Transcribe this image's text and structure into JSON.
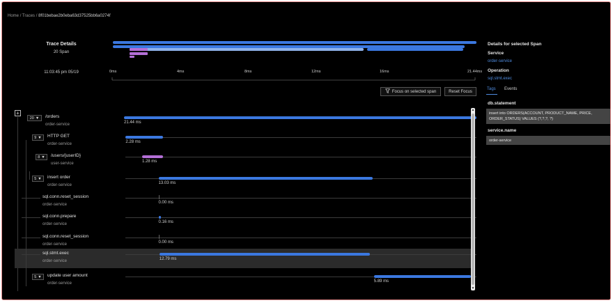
{
  "breadcrumb": {
    "home": "Home",
    "separator": "/",
    "traces": "Traces",
    "trace_id": "8f01bebae2b0eba63d37525bb6a0274f"
  },
  "summary": {
    "title": "Trace Details",
    "span_count": "20 Span",
    "start_time": "11:03:45 pm 05/19"
  },
  "timeline_ticks": [
    "0ms",
    "4ms",
    "8ms",
    "12ms",
    "16ms",
    "21.44ms"
  ],
  "buttons": {
    "focus_icon": "funnel-icon",
    "focus": "Focus on selected span",
    "reset": "Reset Focus"
  },
  "colors": {
    "span_bar": "#3b78e0",
    "user_service_bar": "#b36fd6",
    "link": "#4f8ce0"
  },
  "trace_duration_ms": 21.44,
  "spans": [
    {
      "name": "/orders",
      "service": "order-service",
      "duration": "21.44 ms",
      "start_ms": 0,
      "duration_ms": 21.44,
      "toggle": "20",
      "depth": 0,
      "color": "blue"
    },
    {
      "name": "HTTP GET",
      "service": "order-service",
      "duration": "2.28 ms",
      "start_ms": 0.1,
      "duration_ms": 2.28,
      "toggle": "9",
      "depth": 1,
      "color": "blue"
    },
    {
      "name": "/users/{userID}",
      "service": "user-service",
      "duration": "1.28 ms",
      "start_ms": 1.1,
      "duration_ms": 1.28,
      "toggle": "8",
      "depth": 2,
      "color": "purple"
    },
    {
      "name": "insert order",
      "service": "order-service",
      "duration": "13.03 ms",
      "start_ms": 2.1,
      "duration_ms": 13.03,
      "toggle": "5",
      "depth": 1,
      "color": "blue"
    },
    {
      "name": "sql.conn.reset_session",
      "service": "order-service",
      "duration": "0.00 ms",
      "start_ms": 2.1,
      "duration_ms": 0,
      "toggle": "",
      "depth": 2,
      "color": "blue"
    },
    {
      "name": "sql.conn.prepare",
      "service": "order-service",
      "duration": "0.16 ms",
      "start_ms": 2.1,
      "duration_ms": 0.16,
      "toggle": "",
      "depth": 2,
      "color": "blue"
    },
    {
      "name": "sql.conn.reset_session",
      "service": "order-service",
      "duration": "0.00 ms",
      "start_ms": 2.1,
      "duration_ms": 0,
      "toggle": "",
      "depth": 2,
      "color": "blue"
    },
    {
      "name": "sql.stmt.exec",
      "service": "order-service",
      "duration": "12.79 ms",
      "start_ms": 2.15,
      "duration_ms": 12.79,
      "toggle": "",
      "depth": 2,
      "color": "blue",
      "selected": true
    },
    {
      "name": "update user amount",
      "service": "order-service",
      "duration": "5.89 ms",
      "start_ms": 15.2,
      "duration_ms": 5.89,
      "toggle": "5",
      "depth": 1,
      "color": "blue"
    }
  ],
  "details": {
    "header": "Details for selected Span",
    "service_label": "Service",
    "service_value": "order-service",
    "operation_label": "Operation",
    "operation_value": "sql.stmt.exec",
    "tabs": [
      "Tags",
      "Events"
    ],
    "tags": [
      {
        "key": "db.statement",
        "value": "insert into ORDERS(ACCOUNT, PRODUCT_NAME, PRICE, ORDER_STATUS) VALUES (?,?,?, ?)"
      },
      {
        "key": "service.name",
        "value": "order-service"
      }
    ]
  }
}
